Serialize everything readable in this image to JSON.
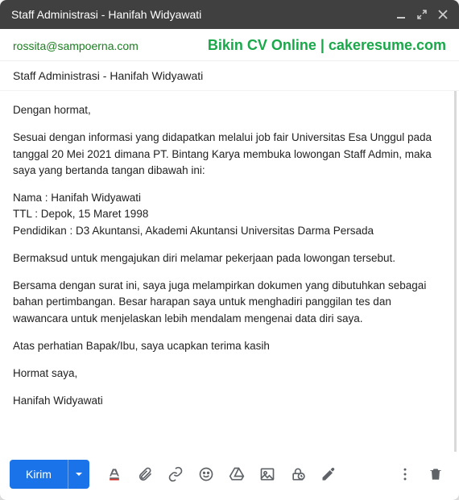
{
  "window": {
    "title": "Staff Administrasi - Hanifah Widyawati"
  },
  "header": {
    "recipient": "rossita@sampoerna.com",
    "promo": "Bikin CV Online | cakeresume.com"
  },
  "subject": "Staff Administrasi - Hanifah Widyawati",
  "body": {
    "p1": "Dengan hormat,",
    "p2": "Sesuai dengan informasi yang didapatkan melalui job fair Universitas Esa Unggul pada tanggal 20 Mei 2021 dimana PT. Bintang Karya membuka lowongan Staff Admin, maka saya yang bertanda tangan dibawah ini:",
    "p3_l1": "Nama : Hanifah Widyawati",
    "p3_l2": "TTL : Depok, 15 Maret 1998",
    "p3_l3": "Pendidikan : D3 Akuntansi, Akademi Akuntansi Universitas Darma Persada",
    "p4": "Bermaksud untuk mengajukan diri melamar pekerjaan pada lowongan tersebut.",
    "p5": "Bersama dengan surat ini, saya juga melampirkan dokumen yang dibutuhkan sebagai bahan pertimbangan. Besar harapan saya untuk menghadiri panggilan tes dan wawancara untuk menjelaskan lebih mendalam mengenai data diri saya.",
    "p6": "Atas perhatian Bapak/Ibu, saya ucapkan terima kasih",
    "p7": "Hormat saya,",
    "p8": "Hanifah Widyawati"
  },
  "toolbar": {
    "send_label": "Kirim"
  }
}
